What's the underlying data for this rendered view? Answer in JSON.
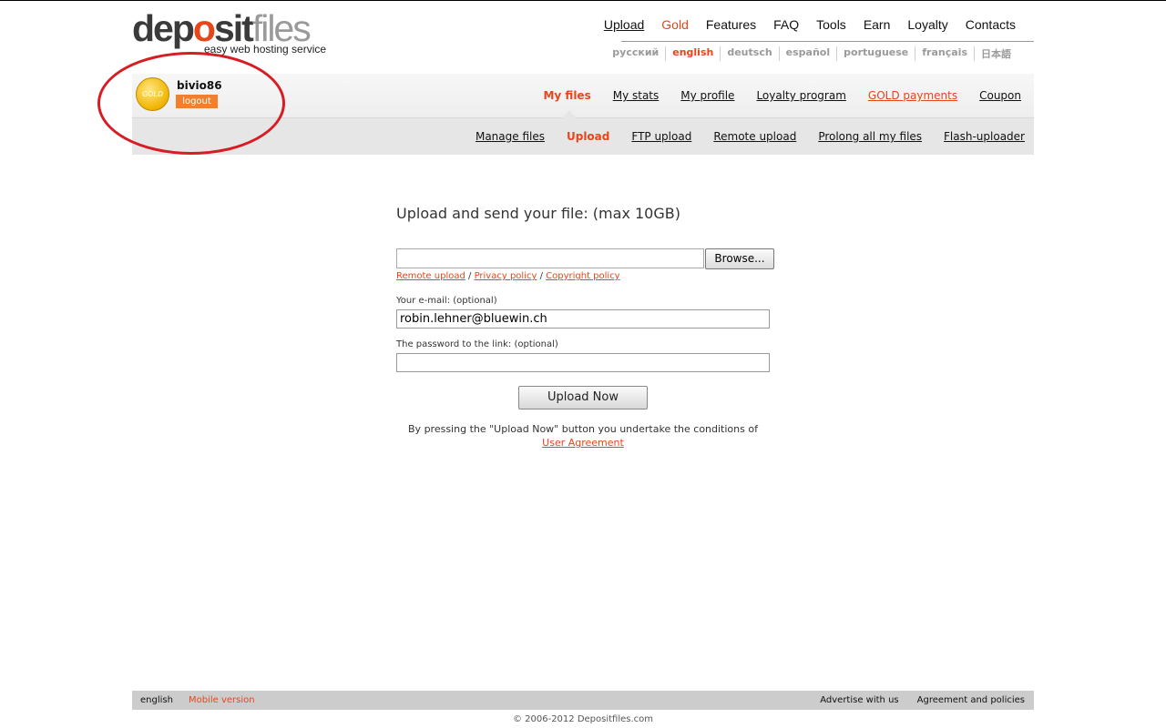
{
  "logo": {
    "part1": "dep",
    "part2": "o",
    "part3": "sit",
    "part4": "files",
    "tagline": "easy web hosting service"
  },
  "topnav": [
    {
      "label": "Upload",
      "style": "ul"
    },
    {
      "label": "Gold",
      "style": "gold"
    },
    {
      "label": "Features",
      "style": ""
    },
    {
      "label": "FAQ",
      "style": ""
    },
    {
      "label": "Tools",
      "style": ""
    },
    {
      "label": "Earn",
      "style": ""
    },
    {
      "label": "Loyalty",
      "style": ""
    },
    {
      "label": "Contacts",
      "style": ""
    }
  ],
  "languages": [
    {
      "label": "русский",
      "active": false
    },
    {
      "label": "english",
      "active": true
    },
    {
      "label": "deutsch",
      "active": false
    },
    {
      "label": "español",
      "active": false
    },
    {
      "label": "portuguese",
      "active": false
    },
    {
      "label": "français",
      "active": false
    },
    {
      "label": "日本語",
      "active": false
    }
  ],
  "user": {
    "badge": "GOLD",
    "name": "bivio86",
    "logout": "logout"
  },
  "mainnav": [
    {
      "label": "My files",
      "style": "active"
    },
    {
      "label": "My stats",
      "style": ""
    },
    {
      "label": "My profile",
      "style": ""
    },
    {
      "label": "Loyalty program",
      "style": ""
    },
    {
      "label": "GOLD payments",
      "style": "gold"
    },
    {
      "label": "Coupon",
      "style": ""
    }
  ],
  "subnav": [
    {
      "label": "Manage files",
      "style": ""
    },
    {
      "label": "Upload",
      "style": "active"
    },
    {
      "label": "FTP upload",
      "style": ""
    },
    {
      "label": "Remote upload",
      "style": ""
    },
    {
      "label": "Prolong all my files",
      "style": ""
    },
    {
      "label": "Flash-uploader",
      "style": ""
    }
  ],
  "form": {
    "title": "Upload and send your file: (max 10GB)",
    "file_value": "",
    "browse": "Browse...",
    "links": {
      "remote": "Remote upload",
      "sep": " / ",
      "privacy": "Privacy policy",
      "copyright": "Copyright policy"
    },
    "email_label": "Your e-mail: (optional)",
    "email_value": "robin.lehner@bluewin.ch",
    "password_label": "The password to the link: (optional)",
    "password_value": "",
    "upload_button": "Upload Now",
    "terms_text": "By pressing the \"Upload Now\" button you undertake the conditions of",
    "terms_link": "User Agreement"
  },
  "footer": {
    "language": "english",
    "mobile": "Mobile version",
    "advertise": "Advertise with us",
    "agreement": "Agreement and policies",
    "copyright": "© 2006-2012 Depositfiles.com"
  },
  "colors": {
    "accent": "#e7461b",
    "annotation_circle": "#d81c24"
  }
}
